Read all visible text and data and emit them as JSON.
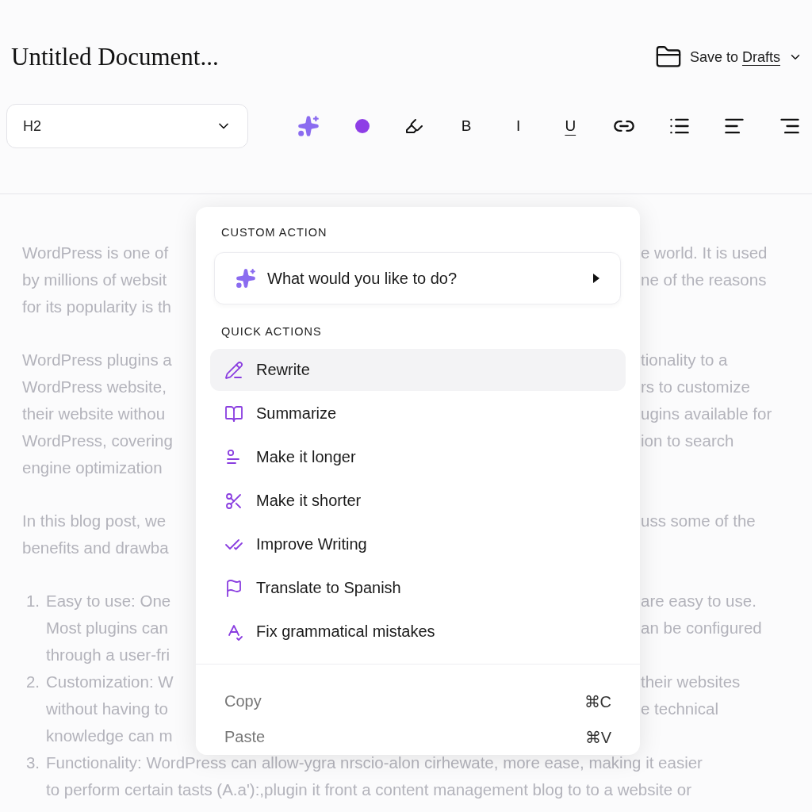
{
  "document": {
    "title": "Untitled Document..."
  },
  "save": {
    "prefix": "Save to",
    "link": "Drafts"
  },
  "toolbar": {
    "block_style": "H2",
    "format_buttons": [
      "B",
      "I",
      "U"
    ]
  },
  "body": [
    {
      "kind": "paragraph",
      "lines": [
        {
          "left": "WordPress is one of",
          "right": "e world. It is used"
        },
        {
          "left": "by millions of websit",
          "right": "ne of the reasons"
        },
        {
          "left": "for its popularity is th"
        }
      ]
    },
    {
      "kind": "paragraph",
      "lines": [
        {
          "left": "WordPress plugins a",
          "right": "tionality to a"
        },
        {
          "left": "WordPress website,",
          "right": "rs to customize"
        },
        {
          "left": "their website withou",
          "right": "ugins available for"
        },
        {
          "left": "WordPress, covering",
          "right": "ion to search"
        },
        {
          "left": "engine optimization"
        }
      ]
    },
    {
      "kind": "paragraph",
      "lines": [
        {
          "left": "In this blog post, we",
          "right": "uss some of the"
        },
        {
          "left": "benefits and drawba"
        }
      ]
    },
    {
      "kind": "list",
      "items": [
        {
          "number": "1.",
          "lines": [
            {
              "left": "Easy to use: One",
              "right": "are easy to use."
            },
            {
              "left": "Most plugins can",
              "right": "an be configured"
            },
            {
              "left": "through a user-fri"
            }
          ]
        },
        {
          "number": "2.",
          "lines": [
            {
              "left": "Customization: W",
              "right": "their websites"
            },
            {
              "left": "without having to",
              "right": "e technical"
            },
            {
              "left": "knowledge can m"
            }
          ]
        },
        {
          "number": "3.",
          "lines": [
            {
              "full": "Functionality: WordPress can allow-ygra nrscio-alon cirhewate, more ease, making it easier"
            },
            {
              "full": "to perform certain tasts (A.a'):,plugin it front a content management blog to to a website or"
            }
          ]
        }
      ]
    }
  ],
  "menu": {
    "custom_action": {
      "heading": "CUSTOM ACTION",
      "prompt": "What would you like to do?"
    },
    "quick_actions": {
      "heading": "QUICK ACTIONS",
      "items": [
        {
          "label": "Rewrite",
          "selected": true
        },
        {
          "label": "Summarize",
          "selected": false
        },
        {
          "label": "Make it longer",
          "selected": false
        },
        {
          "label": "Make it shorter",
          "selected": false
        },
        {
          "label": "Improve Writing",
          "selected": false
        },
        {
          "label": "Translate to Spanish",
          "selected": false
        },
        {
          "label": "Fix grammatical mistakes",
          "selected": false
        }
      ]
    },
    "clipboard": [
      {
        "label": "Copy",
        "shortcut": "⌘C"
      },
      {
        "label": "Paste",
        "shortcut": "⌘V"
      }
    ]
  }
}
